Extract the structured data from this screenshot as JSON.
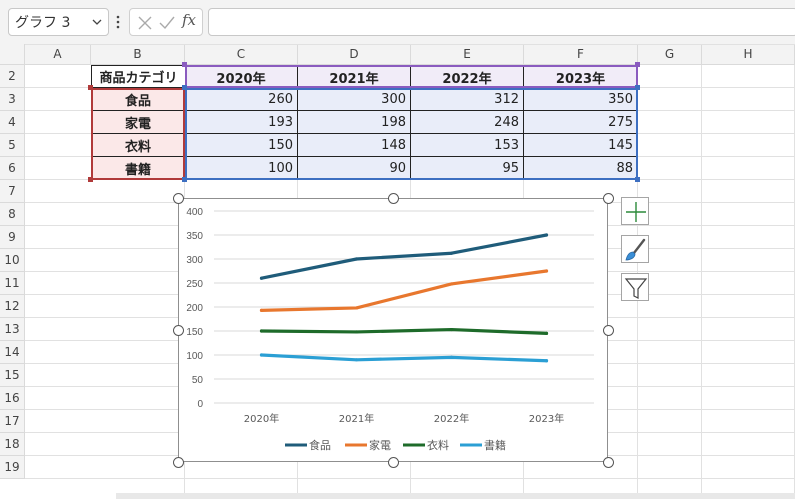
{
  "formula_bar": {
    "name_box": "グラフ 3",
    "fx_label": "fx",
    "formula": ""
  },
  "icons": {
    "name_dropdown": "chevron-down-icon",
    "more": "vertical-dots-icon",
    "cancel": "cancel-x-icon",
    "enter": "check-icon",
    "chart_elements": "plus-icon",
    "chart_styles": "paintbrush-icon",
    "chart_filters": "filter-icon"
  },
  "columns": [
    "A",
    "B",
    "C",
    "D",
    "E",
    "F",
    "G",
    "H"
  ],
  "rows": [
    "2",
    "3",
    "4",
    "5",
    "6",
    "7",
    "8",
    "9",
    "10",
    "11",
    "12",
    "13",
    "14",
    "15",
    "16",
    "17",
    "18",
    "19"
  ],
  "table": {
    "corner": "商品カテゴリ",
    "years": [
      "2020年",
      "2021年",
      "2022年",
      "2023年"
    ],
    "categories": [
      "食品",
      "家電",
      "衣料",
      "書籍"
    ],
    "values": [
      [
        "260",
        "300",
        "312",
        "350"
      ],
      [
        "193",
        "198",
        "248",
        "275"
      ],
      [
        "150",
        "148",
        "153",
        "145"
      ],
      [
        "100",
        "90",
        "95",
        "88"
      ]
    ]
  },
  "colors": {
    "header_fill": "#f1ecf8",
    "category_fill": "#fbe8e8",
    "value_fill": "#e9edf9",
    "purple_range": "#8a5bbf",
    "red_range": "#b03a3a",
    "blue_range": "#3d6fc1"
  },
  "chart_data": {
    "type": "line",
    "categories": [
      "2020年",
      "2021年",
      "2022年",
      "2023年"
    ],
    "yticks": [
      "0",
      "50",
      "100",
      "150",
      "200",
      "250",
      "300",
      "350",
      "400"
    ],
    "ylim": [
      0,
      400
    ],
    "grid": true,
    "legend": "bottom",
    "series": [
      {
        "name": "食品",
        "values": [
          260,
          300,
          312,
          350
        ],
        "color": "#1f5c7a"
      },
      {
        "name": "家電",
        "values": [
          193,
          198,
          248,
          275
        ],
        "color": "#e8772e"
      },
      {
        "name": "衣料",
        "values": [
          150,
          148,
          153,
          145
        ],
        "color": "#1e6b2a"
      },
      {
        "name": "書籍",
        "values": [
          100,
          90,
          95,
          88
        ],
        "color": "#2b9fd4"
      }
    ]
  }
}
